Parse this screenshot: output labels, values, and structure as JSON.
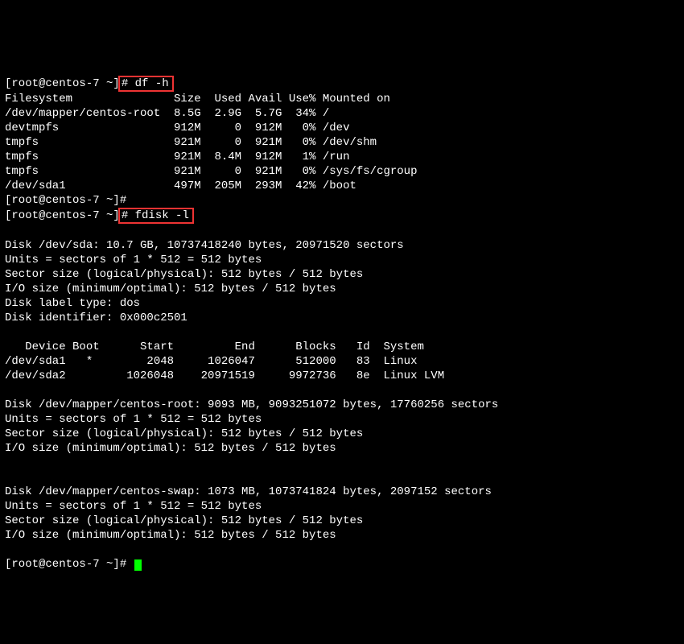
{
  "prompt1": {
    "prefix": "[root@centos-7 ~]",
    "cmd": "# df -h"
  },
  "df_header": "Filesystem               Size  Used Avail Use% Mounted on",
  "df_rows": [
    "/dev/mapper/centos-root  8.5G  2.9G  5.7G  34% /",
    "devtmpfs                 912M     0  912M   0% /dev",
    "tmpfs                    921M     0  921M   0% /dev/shm",
    "tmpfs                    921M  8.4M  912M   1% /run",
    "tmpfs                    921M     0  921M   0% /sys/fs/cgroup",
    "/dev/sda1                497M  205M  293M  42% /boot"
  ],
  "prompt2": "[root@centos-7 ~]#",
  "prompt3": {
    "prefix": "[root@centos-7 ~]",
    "cmd": "# fdisk -l"
  },
  "blank": "",
  "fdisk_sda": [
    "Disk /dev/sda: 10.7 GB, 10737418240 bytes, 20971520 sectors",
    "Units = sectors of 1 * 512 = 512 bytes",
    "Sector size (logical/physical): 512 bytes / 512 bytes",
    "I/O size (minimum/optimal): 512 bytes / 512 bytes",
    "Disk label type: dos",
    "Disk identifier: 0x000c2501"
  ],
  "part_header": "   Device Boot      Start         End      Blocks   Id  System",
  "part_rows": [
    "/dev/sda1   *        2048     1026047      512000   83  Linux",
    "/dev/sda2         1026048    20971519     9972736   8e  Linux LVM"
  ],
  "fdisk_root": [
    "Disk /dev/mapper/centos-root: 9093 MB, 9093251072 bytes, 17760256 sectors",
    "Units = sectors of 1 * 512 = 512 bytes",
    "Sector size (logical/physical): 512 bytes / 512 bytes",
    "I/O size (minimum/optimal): 512 bytes / 512 bytes"
  ],
  "fdisk_swap": [
    "Disk /dev/mapper/centos-swap: 1073 MB, 1073741824 bytes, 2097152 sectors",
    "Units = sectors of 1 * 512 = 512 bytes",
    "Sector size (logical/physical): 512 bytes / 512 bytes",
    "I/O size (minimum/optimal): 512 bytes / 512 bytes"
  ],
  "prompt_end": "[root@centos-7 ~]# "
}
